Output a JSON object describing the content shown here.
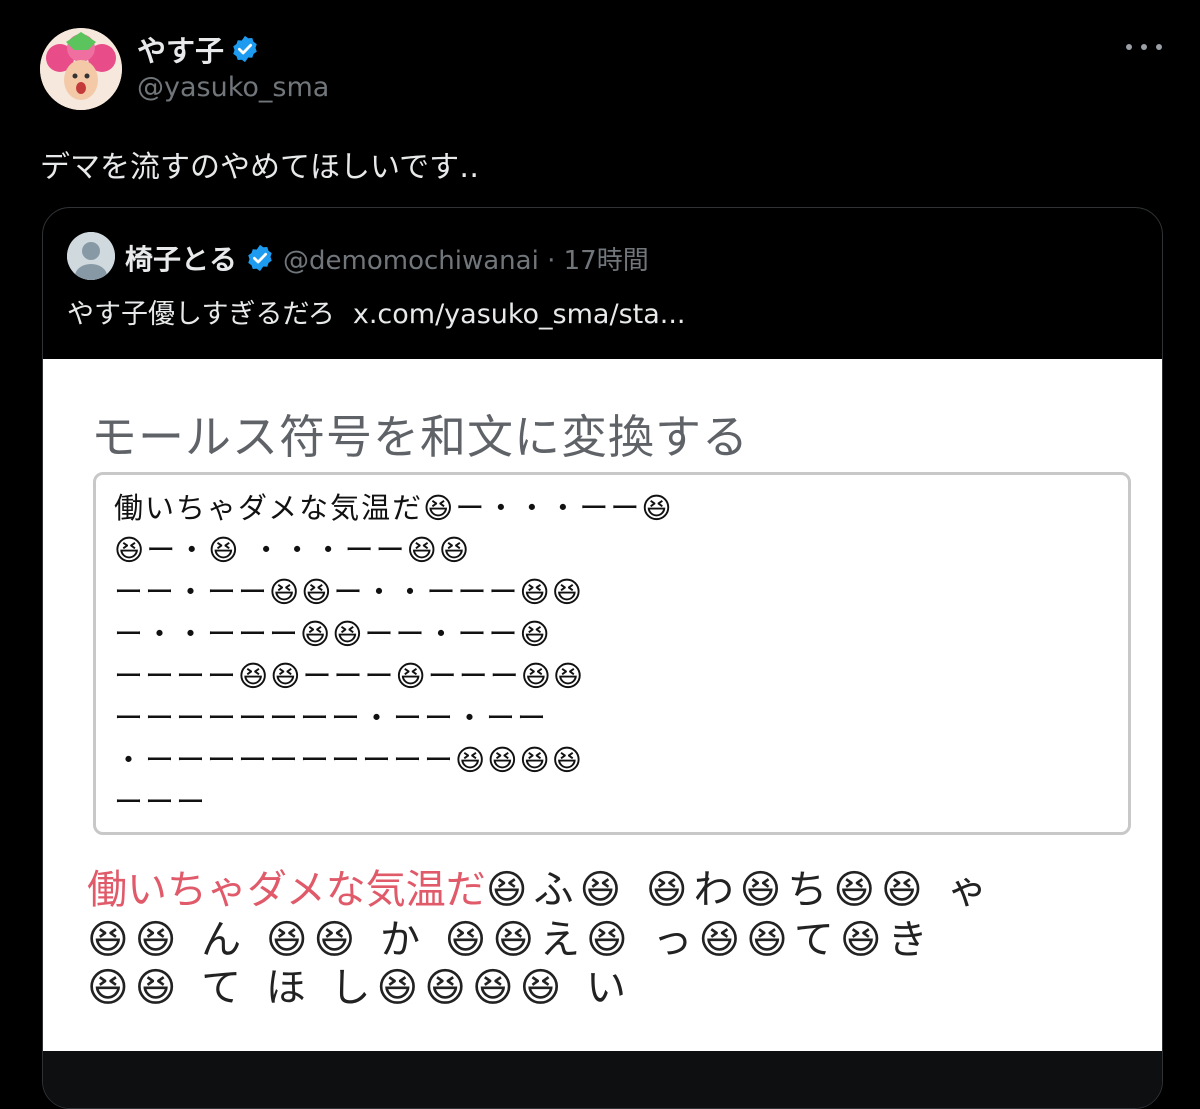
{
  "tweet": {
    "display_name": "やす子",
    "handle": "@yasuko_sma",
    "text": "デマを流すのやめてほしいです‥"
  },
  "quote": {
    "name": "椅子とる",
    "handle_time": "@demomochiwanai · 17時間",
    "text": "やす子優しすぎるだろ",
    "link": "x.com/yasuko_sma/sta..."
  },
  "embed": {
    "title": "モールス符号を和文に変換する",
    "code_lines": [
      "働いちゃダメな気温だ😆ー・・・ーー😆",
      "😆ー・😆 ・・・ーー😆😆",
      "ーー・ーー😆😆ー・・ーーー😆😆",
      "ー・・ーーー😆😆ーー・ーー😆",
      "ーーーー😆😆ーーー😆ーーー😆😆",
      "ーーーーーーーー・ーー・ーー",
      "・ーーーーーーーーーー😆😆😆😆",
      "ーーー"
    ],
    "result_pink": "働いちゃダメな気温だ",
    "result_line1_rest": "😆ふ😆 😆わ😆ち😆😆 ゃ",
    "result_line2": "😆😆 ん 😆😆  か 😆😆え😆 っ😆😆て😆き",
    "result_line3": "😆😆 て ほ し😆😆😆😆 い"
  },
  "colors": {
    "background": "#000000",
    "text": "#e7e9ea",
    "muted": "#71767b",
    "verified": "#1d9bf0",
    "pink": "#e05a6a"
  }
}
